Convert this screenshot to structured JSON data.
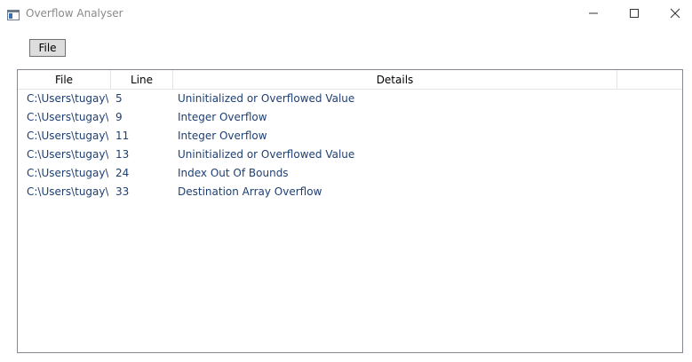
{
  "window": {
    "title": "Overflow Analyser"
  },
  "toolbar": {
    "file_label": "File"
  },
  "list": {
    "columns": [
      "File",
      "Line",
      "Details"
    ],
    "rows": [
      {
        "file": "C:\\Users\\tugay\\s",
        "line": "5",
        "details": "Uninitialized or Overflowed Value"
      },
      {
        "file": "C:\\Users\\tugay\\s",
        "line": "9",
        "details": "Integer Overflow"
      },
      {
        "file": "C:\\Users\\tugay\\s",
        "line": "11",
        "details": "Integer Overflow"
      },
      {
        "file": "C:\\Users\\tugay\\s",
        "line": "13",
        "details": "Uninitialized or Overflowed Value"
      },
      {
        "file": "C:\\Users\\tugay\\s",
        "line": "24",
        "details": "Index Out Of Bounds"
      },
      {
        "file": "C:\\Users\\tugay\\s",
        "line": "33",
        "details": "Destination Array Overflow"
      }
    ]
  },
  "colors": {
    "row_text": "#1e3f73",
    "title_text": "#8a8a8a",
    "button_bg": "#dddddd",
    "border": "#828790"
  },
  "icons": {
    "app": "app-window-icon",
    "minimize": "minimize-icon",
    "maximize": "maximize-icon",
    "close": "close-icon"
  }
}
